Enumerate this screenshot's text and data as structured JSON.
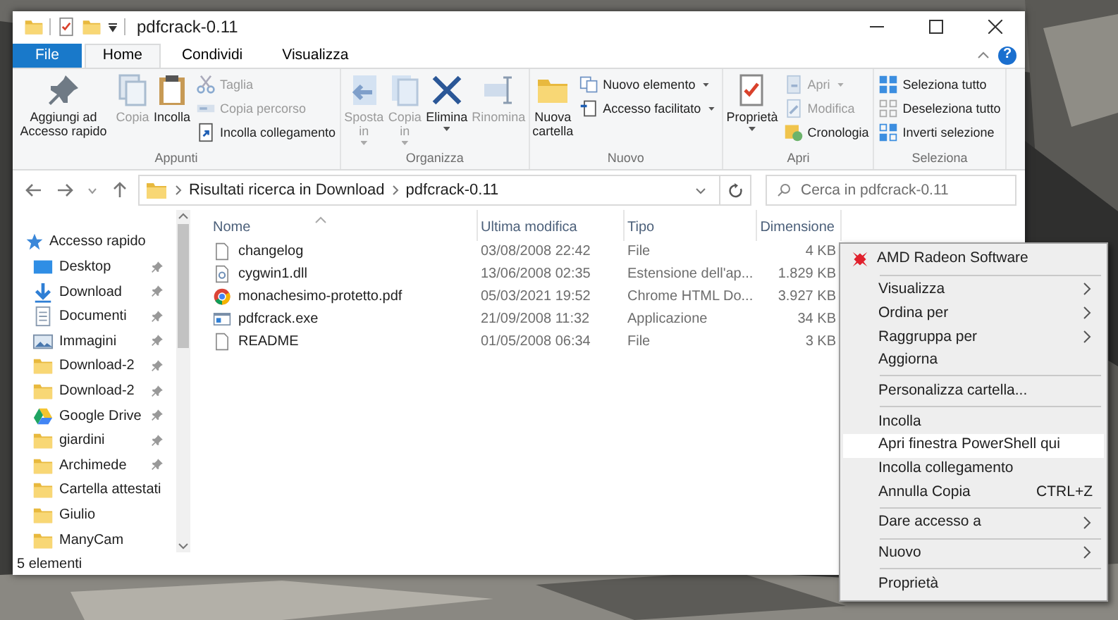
{
  "window": {
    "title": "pdfcrack-0.11",
    "help": "?"
  },
  "ribbon_tabs": [
    {
      "label": "File",
      "kind": "file",
      "selected": false
    },
    {
      "label": "Home",
      "kind": "tab",
      "selected": true
    },
    {
      "label": "Condividi",
      "kind": "tab",
      "selected": false
    },
    {
      "label": "Visualizza",
      "kind": "tab",
      "selected": false
    }
  ],
  "ribbon_groups": [
    {
      "label": "Appunti",
      "items": [
        {
          "label": "Aggiungi ad Accesso rapido",
          "kind": "large",
          "disabled": false,
          "dropdown": false
        },
        {
          "label": "Copia",
          "kind": "large",
          "disabled": true,
          "dropdown": false
        },
        {
          "label": "Incolla",
          "kind": "large",
          "disabled": false,
          "dropdown": false
        },
        {
          "label": "Taglia",
          "kind": "small",
          "disabled": true,
          "dropdown": false
        },
        {
          "label": "Copia percorso",
          "kind": "small",
          "disabled": true,
          "dropdown": false
        },
        {
          "label": "Incolla collegamento",
          "kind": "small",
          "disabled": false,
          "dropdown": false
        }
      ]
    },
    {
      "label": "Organizza",
      "items": [
        {
          "label": "Sposta in",
          "kind": "large",
          "disabled": true,
          "dropdown": true
        },
        {
          "label": "Copia in",
          "kind": "large",
          "disabled": true,
          "dropdown": true
        },
        {
          "label": "Elimina",
          "kind": "large",
          "disabled": false,
          "dropdown": true
        },
        {
          "label": "Rinomina",
          "kind": "large",
          "disabled": true,
          "dropdown": false
        }
      ]
    },
    {
      "label": "Nuovo",
      "items": [
        {
          "label": "Nuova cartella",
          "kind": "large",
          "disabled": false,
          "dropdown": false
        },
        {
          "label": "Nuovo elemento",
          "kind": "small",
          "disabled": false,
          "dropdown": true
        },
        {
          "label": "Accesso facilitato",
          "kind": "small",
          "disabled": false,
          "dropdown": true
        }
      ]
    },
    {
      "label": "Apri",
      "items": [
        {
          "label": "Proprietà",
          "kind": "large",
          "disabled": false,
          "dropdown": true
        },
        {
          "label": "Apri",
          "kind": "small",
          "disabled": true,
          "dropdown": true
        },
        {
          "label": "Modifica",
          "kind": "small",
          "disabled": true,
          "dropdown": false
        },
        {
          "label": "Cronologia",
          "kind": "small",
          "disabled": false,
          "dropdown": false
        }
      ]
    },
    {
      "label": "Seleziona",
      "items": [
        {
          "label": "Seleziona tutto",
          "kind": "small",
          "disabled": false,
          "dropdown": false
        },
        {
          "label": "Deseleziona tutto",
          "kind": "small",
          "disabled": false,
          "dropdown": false
        },
        {
          "label": "Inverti selezione",
          "kind": "small",
          "disabled": false,
          "dropdown": false
        }
      ]
    }
  ],
  "address_bar": {
    "path": [
      "Risultati ricerca in Download",
      "pdfcrack-0.11"
    ]
  },
  "search": {
    "placeholder": "Cerca in pdfcrack-0.11"
  },
  "sidebar": {
    "header": "Accesso rapido",
    "items": [
      {
        "label": "Desktop",
        "kind": "desktop",
        "pinned": true
      },
      {
        "label": "Download",
        "kind": "download",
        "pinned": true
      },
      {
        "label": "Documenti",
        "kind": "documents",
        "pinned": true
      },
      {
        "label": "Immagini",
        "kind": "pictures",
        "pinned": true
      },
      {
        "label": "Download-2",
        "kind": "folder",
        "pinned": true
      },
      {
        "label": "Download-2",
        "kind": "folder",
        "pinned": true
      },
      {
        "label": "Google Drive",
        "kind": "drive",
        "pinned": true
      },
      {
        "label": "giardini",
        "kind": "folder",
        "pinned": true
      },
      {
        "label": "Archimede",
        "kind": "folder",
        "pinned": true
      },
      {
        "label": "Cartella attestati",
        "kind": "folder",
        "pinned": false
      },
      {
        "label": "Giulio",
        "kind": "folder",
        "pinned": false
      },
      {
        "label": "ManyCam",
        "kind": "folder",
        "pinned": false
      }
    ]
  },
  "table": {
    "columns": [
      "Nome",
      "Ultima modifica",
      "Tipo",
      "Dimensione"
    ],
    "rows": [
      {
        "kind": "file",
        "cells": [
          "changelog",
          "03/08/2008 22:42",
          "File",
          "4 KB"
        ]
      },
      {
        "kind": "dll",
        "cells": [
          "cygwin1.dll",
          "13/06/2008 02:35",
          "Estensione dell'ap...",
          "1.829 KB"
        ]
      },
      {
        "kind": "browser",
        "cells": [
          "monachesimo-protetto.pdf",
          "05/03/2021 19:52",
          "Chrome HTML Do...",
          "3.927 KB"
        ]
      },
      {
        "kind": "exe",
        "cells": [
          "pdfcrack.exe",
          "21/09/2008 11:32",
          "Applicazione",
          "34 KB"
        ]
      },
      {
        "kind": "file",
        "cells": [
          "README",
          "01/05/2008 06:34",
          "File",
          "3 KB"
        ]
      }
    ]
  },
  "status_bar": "5 elementi",
  "context_menu": [
    {
      "kind": "header",
      "label": "AMD Radeon Software"
    },
    {
      "kind": "separator"
    },
    {
      "kind": "item",
      "label": "Visualizza",
      "submenu": true,
      "selected": false
    },
    {
      "kind": "item",
      "label": "Ordina per",
      "submenu": true,
      "selected": false
    },
    {
      "kind": "item",
      "label": "Raggruppa per",
      "submenu": true,
      "selected": false
    },
    {
      "kind": "item",
      "label": "Aggiorna",
      "submenu": false,
      "selected": false
    },
    {
      "kind": "separator"
    },
    {
      "kind": "item",
      "label": "Personalizza cartella...",
      "submenu": false,
      "selected": false
    },
    {
      "kind": "separator"
    },
    {
      "kind": "item",
      "label": "Incolla",
      "submenu": false,
      "selected": false
    },
    {
      "kind": "item",
      "label": "Apri finestra PowerShell qui",
      "submenu": false,
      "selected": true
    },
    {
      "kind": "item",
      "label": "Incolla collegamento",
      "submenu": false,
      "selected": false
    },
    {
      "kind": "item",
      "label": "Annulla Copia",
      "shortcut": "CTRL+Z",
      "submenu": false,
      "selected": false
    },
    {
      "kind": "separator"
    },
    {
      "kind": "item",
      "label": "Dare accesso a",
      "submenu": true,
      "selected": false
    },
    {
      "kind": "separator"
    },
    {
      "kind": "item",
      "label": "Nuovo",
      "submenu": true,
      "selected": false
    },
    {
      "kind": "separator"
    },
    {
      "kind": "item",
      "label": "Proprietà",
      "submenu": false,
      "selected": false
    }
  ]
}
